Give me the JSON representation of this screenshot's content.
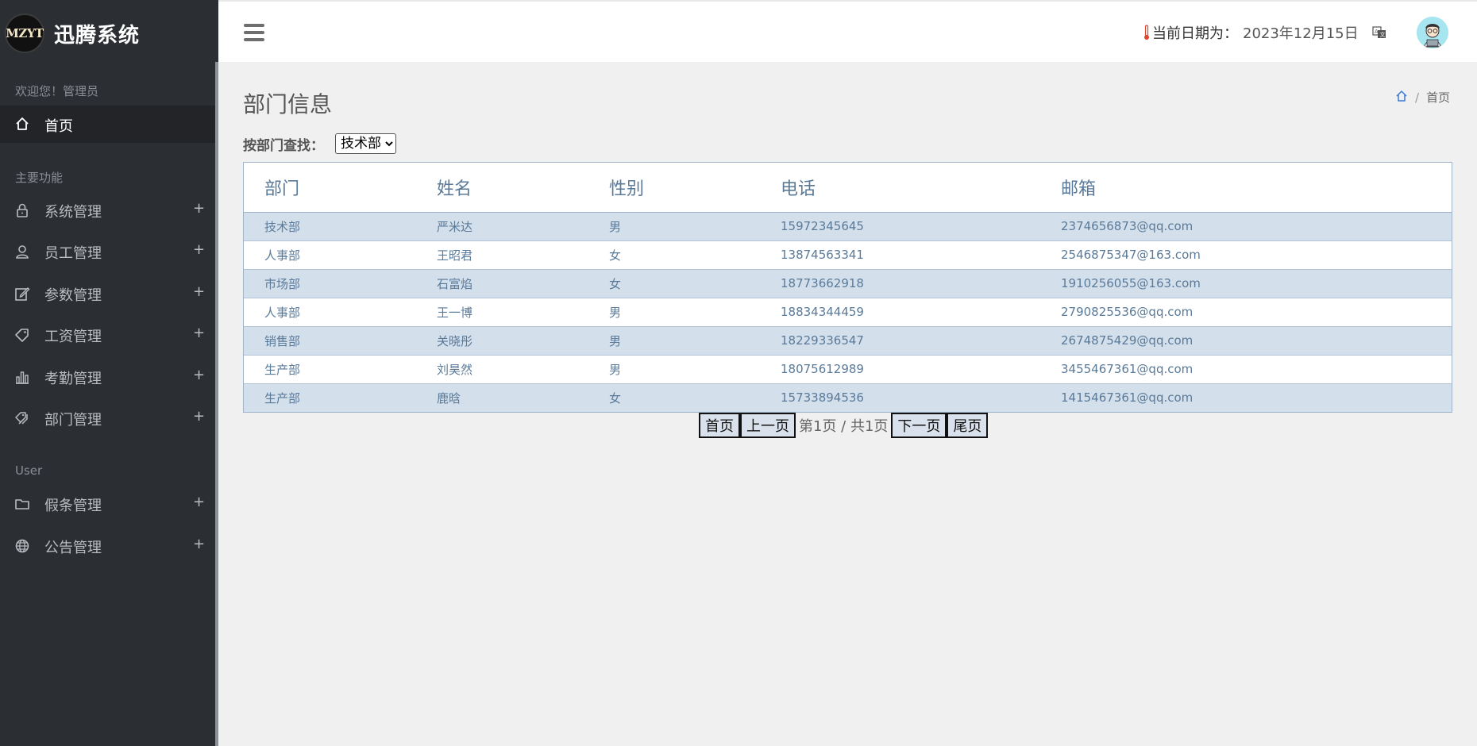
{
  "sidebar": {
    "logo_text": "MZYT",
    "app_title": "迅腾系统",
    "welcome": "欢迎您！管理员",
    "home_label": "首页",
    "section_main": "主要功能",
    "section_user": "User",
    "items": [
      {
        "label": "系统管理",
        "icon": "lock-icon",
        "expand": "+"
      },
      {
        "label": "员工管理",
        "icon": "user-icon",
        "expand": "+"
      },
      {
        "label": "参数管理",
        "icon": "edit-icon",
        "expand": "+"
      },
      {
        "label": "工资管理",
        "icon": "tag-icon",
        "expand": "+"
      },
      {
        "label": "考勤管理",
        "icon": "bar-chart-icon",
        "expand": "+"
      },
      {
        "label": "部门管理",
        "icon": "price-tags-icon",
        "expand": "+"
      }
    ],
    "user_items": [
      {
        "label": "假条管理",
        "icon": "folder-icon",
        "expand": "+"
      },
      {
        "label": "公告管理",
        "icon": "globe-icon",
        "expand": "+"
      }
    ]
  },
  "header": {
    "date_label": "当前日期为：",
    "date_value": "2023年12月15日"
  },
  "main": {
    "page_title": "部门信息",
    "breadcrumb_home": "首页",
    "breadcrumb_sep": "/",
    "filter_label": "按部门查找：",
    "filter_selected": "技术部",
    "table": {
      "headers": [
        "部门",
        "姓名",
        "性别",
        "电话",
        "邮箱"
      ],
      "rows": [
        [
          "技术部",
          "严米达",
          "男",
          "15972345645",
          "2374656873@qq.com"
        ],
        [
          "人事部",
          "王昭君",
          "女",
          "13874563341",
          "2546875347@163.com"
        ],
        [
          "市场部",
          "石富焰",
          "女",
          "18773662918",
          "1910256055@163.com"
        ],
        [
          "人事部",
          "王一博",
          "男",
          "18834344459",
          "2790825536@qq.com"
        ],
        [
          "销售部",
          "关晓彤",
          "男",
          "18229336547",
          "2674875429@qq.com"
        ],
        [
          "生产部",
          "刘昊然",
          "男",
          "18075612989",
          "3455467361@qq.com"
        ],
        [
          "生产部",
          "鹿晗",
          "女",
          "15733894536",
          "1415467361@qq.com"
        ]
      ]
    },
    "pager": {
      "first": "首页",
      "prev": "上一页",
      "info": "第1页 / 共1页",
      "next": "下一页",
      "last": "尾页"
    }
  },
  "colors": {
    "sidebar_bg": "#2b2e33",
    "row_shade": "#d3dfeb",
    "table_text": "#5a7a99"
  }
}
